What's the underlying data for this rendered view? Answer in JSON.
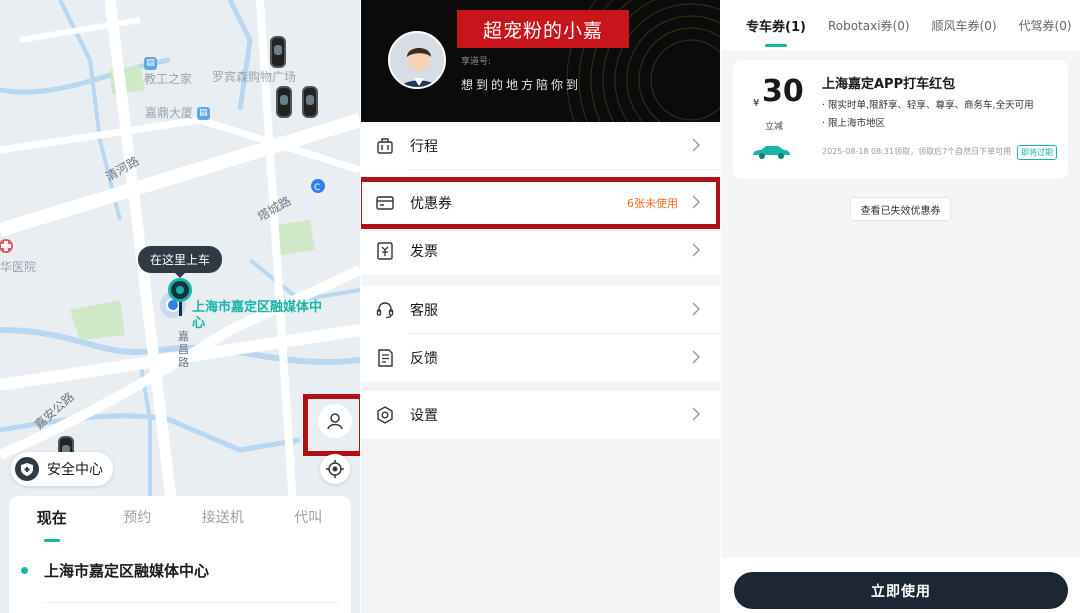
{
  "map": {
    "pois": [
      "教工之家",
      "罗宾森购物广场",
      "嘉鼎大厦",
      "华医院"
    ],
    "roads": [
      "清河路",
      "塔城路",
      "嘉昌路",
      "嘉安公路"
    ],
    "pickup_tip": "在这里上车",
    "place_label": "上海市嘉定区融媒体中心",
    "safety_label": "安全中心"
  },
  "ride": {
    "tabs": [
      "现在",
      "预约",
      "接送机",
      "代叫"
    ],
    "active_tab": "现在",
    "origin": "上海市嘉定区融媒体中心"
  },
  "profile": {
    "nickname": "超宠粉的小嘉",
    "member_label": "享道号:",
    "slogan": "想到的地方陪你到"
  },
  "menu": {
    "trip": "行程",
    "coupon": "优惠券",
    "coupon_sub": "6张未使用",
    "invoice": "发票",
    "service": "客服",
    "feedback": "反馈",
    "settings": "设置"
  },
  "coupons": {
    "tabs": [
      "专车券(1)",
      "Robotaxi券(0)",
      "顺风车券(0)",
      "代驾券(0)"
    ],
    "active_tab": "专车券(1)",
    "card": {
      "currency": "¥",
      "amount": "30",
      "type": "立减",
      "title": "上海嘉定APP打车红包",
      "conditions": [
        "· 限实时单,限舒享、轻享、尊享、商务车,全天可用",
        "· 限上海市地区"
      ],
      "validity": "2025-08-18 08:31领取，领取后7个自然日下单可用",
      "badge": "即将过期"
    },
    "expired_link": "查看已失效优惠券",
    "use_button": "立即使用"
  },
  "colors": {
    "accent": "#16b5a5",
    "highlight_box": "#b11116",
    "nickname_bg": "#c8141b",
    "coupon_sub": "#f26a1b",
    "primary_button": "#1c2733"
  }
}
